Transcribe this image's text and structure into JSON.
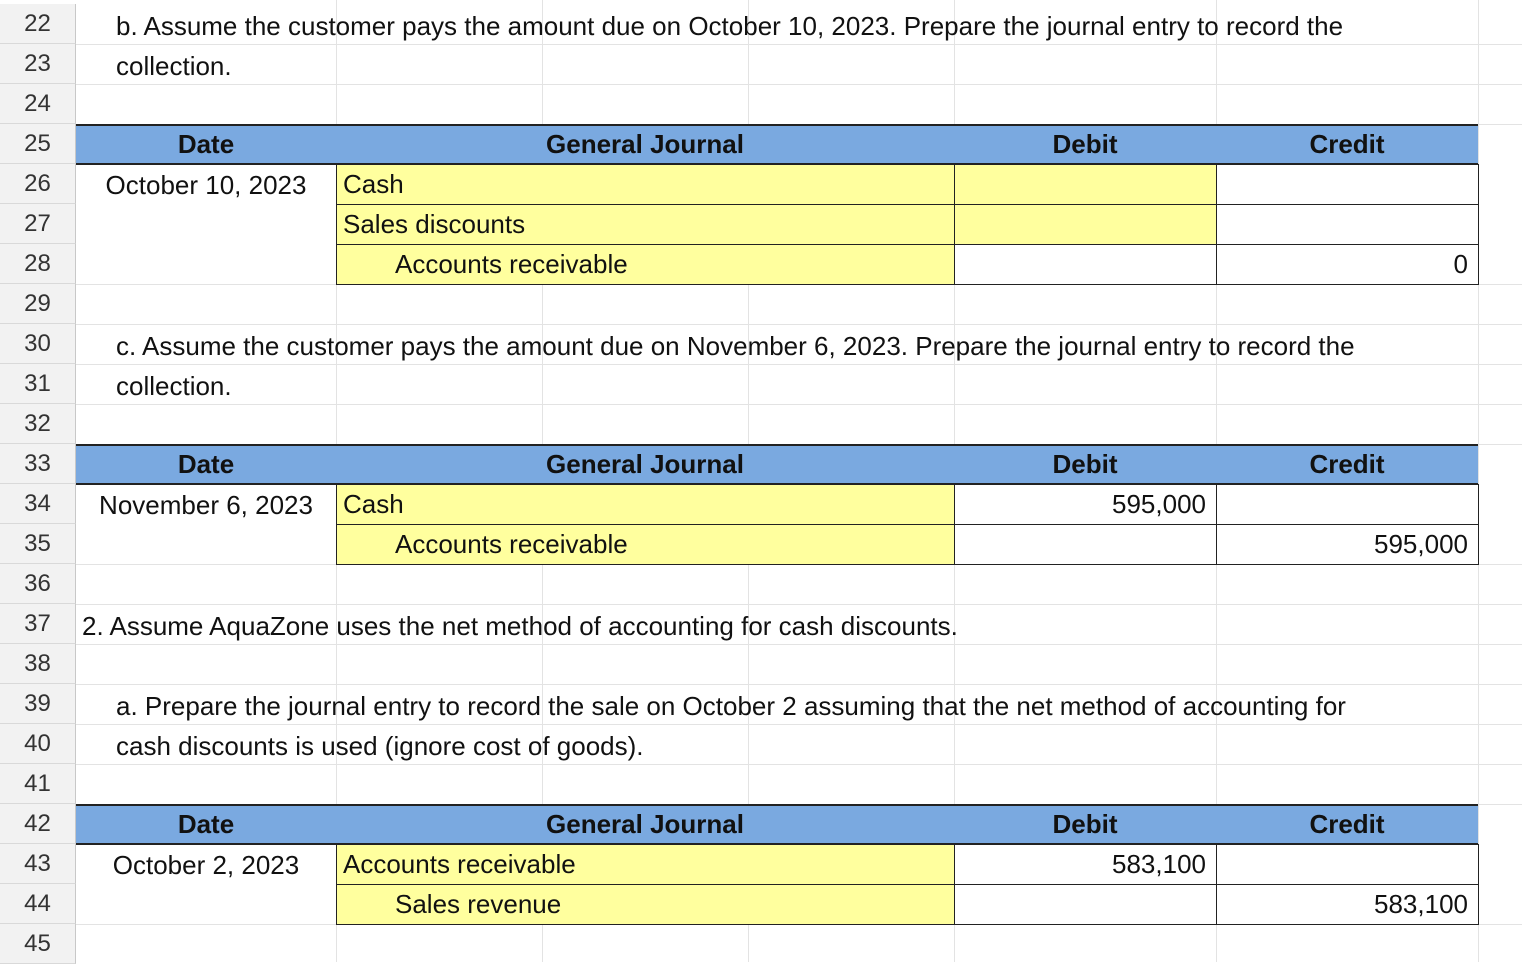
{
  "row_numbers": [
    "22",
    "23",
    "24",
    "25",
    "26",
    "27",
    "28",
    "29",
    "30",
    "31",
    "32",
    "33",
    "34",
    "35",
    "36",
    "37",
    "38",
    "39",
    "40",
    "41",
    "42",
    "43",
    "44",
    "45"
  ],
  "part_b": {
    "line1": "b. Assume the customer pays the amount due on October 10, 2023.  Prepare the journal entry to record the",
    "line2": "collection.",
    "headers": {
      "date": "Date",
      "journal": "General Journal",
      "debit": "Debit",
      "credit": "Credit"
    },
    "date": "October 10, 2023",
    "rows": [
      {
        "account": "Cash",
        "debit": "",
        "credit": ""
      },
      {
        "account": "Sales discounts",
        "debit": "",
        "credit": ""
      },
      {
        "account": "Accounts receivable",
        "debit": "",
        "credit": "0"
      }
    ]
  },
  "part_c": {
    "line1": "c. Assume the customer pays the amount due on November 6, 2023.  Prepare the journal entry to record the",
    "line2": "collection.",
    "headers": {
      "date": "Date",
      "journal": "General Journal",
      "debit": "Debit",
      "credit": "Credit"
    },
    "date": "November 6, 2023",
    "rows": [
      {
        "account": "Cash",
        "debit": "595,000",
        "credit": ""
      },
      {
        "account": "Accounts receivable",
        "debit": "",
        "credit": "595,000"
      }
    ]
  },
  "section2": {
    "title": "2. Assume AquaZone uses the net method of accounting for cash discounts."
  },
  "part_2a": {
    "line1": "a. Prepare the journal entry to record the sale on October 2 assuming that the net method of accounting for",
    "line2": "cash discounts is used (ignore cost of goods).",
    "headers": {
      "date": "Date",
      "journal": "General Journal",
      "debit": "Debit",
      "credit": "Credit"
    },
    "date": "October 2, 2023",
    "rows": [
      {
        "account": "Accounts receivable",
        "debit": "583,100",
        "credit": ""
      },
      {
        "account": "Sales revenue",
        "debit": "",
        "credit": "583,100"
      }
    ]
  },
  "colors": {
    "header_blue": "#7aa9e0",
    "input_yellow": "#ffff9e",
    "row_header_gray": "#f2f2f2"
  }
}
